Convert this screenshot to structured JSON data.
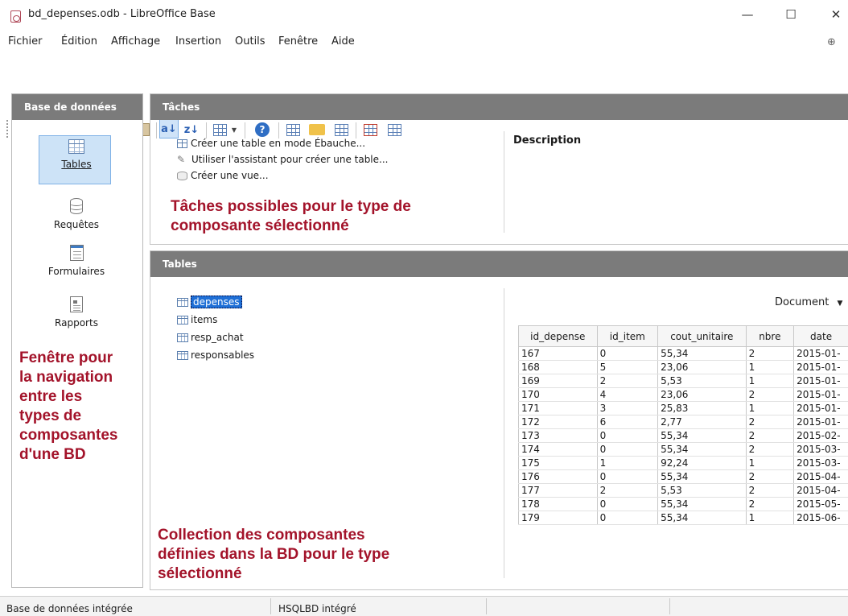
{
  "window": {
    "title": "bd_depenses.odb - LibreOffice Base",
    "minimize": "—",
    "maximize": "☐",
    "close": "✕"
  },
  "menu": [
    "Fichier",
    "Édition",
    "Affichage",
    "Insertion",
    "Outils",
    "Fenêtre",
    "Aide"
  ],
  "toolbar": {
    "sort_asc": "a↓",
    "sort_desc": "z↓",
    "help": "?"
  },
  "nav": {
    "header": "Base de données",
    "items": [
      "Tables",
      "Requêtes",
      "Formulaires",
      "Rapports"
    ],
    "selected": "Tables"
  },
  "tasks": {
    "header": "Tâches",
    "items": [
      "Créer une table en mode Ébauche...",
      "Utiliser l'assistant pour créer une table...",
      "Créer une vue..."
    ],
    "description_label": "Description"
  },
  "tables": {
    "header": "Tables",
    "list": [
      "depenses",
      "items",
      "resp_achat",
      "responsables"
    ],
    "selected": "depenses",
    "preview_mode": "Document"
  },
  "grid": {
    "columns": [
      "id_depense",
      "id_item",
      "cout_unitaire",
      "nbre",
      "date"
    ],
    "rows": [
      [
        "167",
        "0",
        "55,34",
        "2",
        "2015-01-"
      ],
      [
        "168",
        "5",
        "23,06",
        "1",
        "2015-01-"
      ],
      [
        "169",
        "2",
        "5,53",
        "1",
        "2015-01-"
      ],
      [
        "170",
        "4",
        "23,06",
        "2",
        "2015-01-"
      ],
      [
        "171",
        "3",
        "25,83",
        "1",
        "2015-01-"
      ],
      [
        "172",
        "6",
        "2,77",
        "2",
        "2015-01-"
      ],
      [
        "173",
        "0",
        "55,34",
        "2",
        "2015-02-"
      ],
      [
        "174",
        "0",
        "55,34",
        "2",
        "2015-03-"
      ],
      [
        "175",
        "1",
        "92,24",
        "1",
        "2015-03-"
      ],
      [
        "176",
        "0",
        "55,34",
        "2",
        "2015-04-"
      ],
      [
        "177",
        "2",
        "5,53",
        "2",
        "2015-04-"
      ],
      [
        "178",
        "0",
        "55,34",
        "2",
        "2015-05-"
      ],
      [
        "179",
        "0",
        "55,34",
        "1",
        "2015-06-"
      ]
    ]
  },
  "annotations": {
    "tasks": "Tâches possibles pour le type de\ncomposante sélectionné",
    "nav": "Fenêtre pour\nla navigation\nentre les\ntypes de\ncomposantes\nd'une BD",
    "collection": "Collection des composantes\ndéfinies dans la BD pour le type\nsélectionné"
  },
  "status": {
    "left": "Base de données intégrée",
    "engine": "HSQLBD intégré"
  },
  "colors": {
    "annotation": "#a3132a",
    "header_bg": "#7b7b7b",
    "selection": "#1f6fd6"
  }
}
